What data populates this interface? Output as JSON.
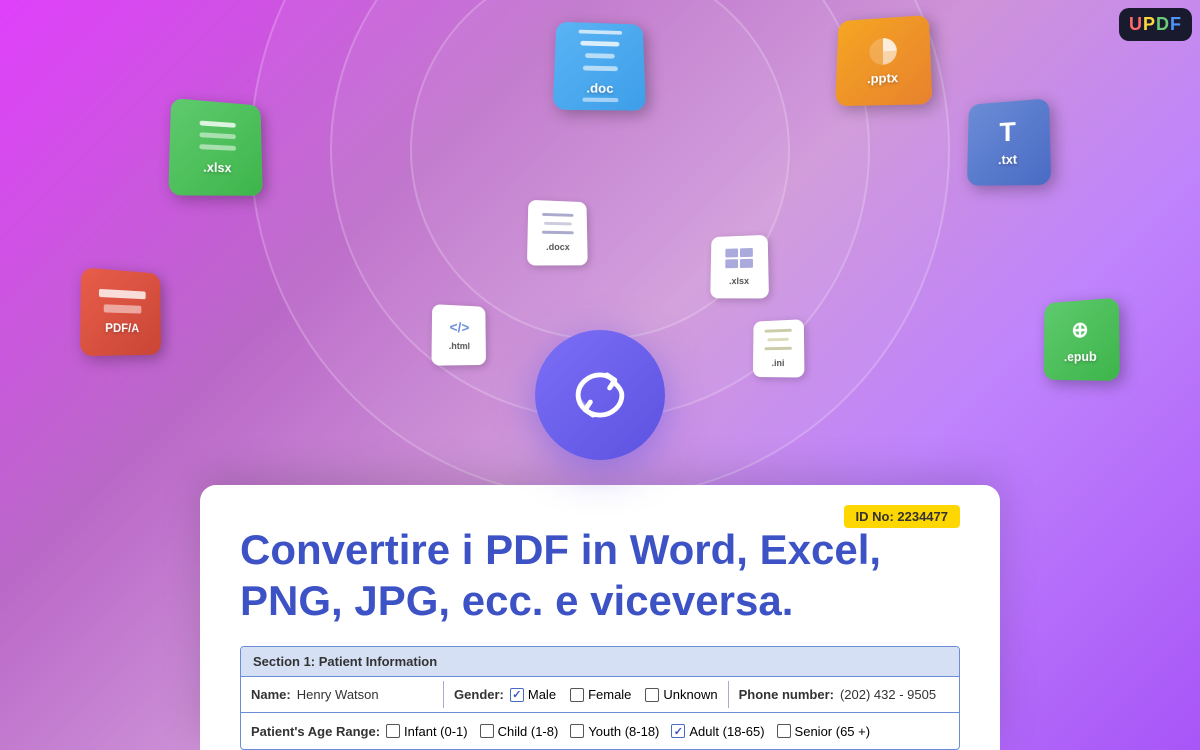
{
  "app": {
    "logo": "UPDF",
    "logo_letters": [
      "U",
      "P",
      "D",
      "F"
    ]
  },
  "hero": {
    "id_badge": "ID No: 2234477",
    "title_line1": "Convertire i PDF in Word, Excel,",
    "title_line2": "PNG, JPG, ecc. e viceversa.",
    "center_icon_title": "convert-icon"
  },
  "file_icons": [
    {
      "name": ".doc",
      "color_from": "#5ab4f5",
      "color_to": "#3d9ee8",
      "type": "doc"
    },
    {
      "name": ".pptx",
      "color_from": "#f5a623",
      "color_to": "#e8822d",
      "type": "pptx"
    },
    {
      "name": ".xlsx",
      "color_from": "#5fca6e",
      "color_to": "#3db54a",
      "type": "xlsx-large"
    },
    {
      "name": ".txt",
      "color_from": "#6b8dd6",
      "color_to": "#4a6bc4",
      "type": "txt"
    },
    {
      "name": "PDF/A",
      "color_from": "#e85d4a",
      "color_to": "#c94535",
      "type": "pdfa"
    },
    {
      "name": ".epub",
      "color_from": "#5fca6e",
      "color_to": "#3db54a",
      "type": "epub"
    },
    {
      "name": ".docx",
      "type": "small-white"
    },
    {
      "name": ".xlsx",
      "type": "small-white-2"
    },
    {
      "name": ".html",
      "type": "small-white-3"
    },
    {
      "name": ".ini",
      "type": "small-white-4"
    }
  ],
  "patient_form": {
    "section_header": "Section 1: Patient Information",
    "name_label": "Name:",
    "name_value": "Henry Watson",
    "gender_label": "Gender:",
    "genders": [
      {
        "label": "Male",
        "checked": true
      },
      {
        "label": "Female",
        "checked": false
      },
      {
        "label": "Unknown",
        "checked": false
      }
    ],
    "phone_label": "Phone number:",
    "phone_value": "(202) 432 - 9505",
    "age_range_label": "Patient's Age Range:",
    "age_ranges": [
      {
        "label": "Infant (0-1)",
        "checked": false
      },
      {
        "label": "Child (1-8)",
        "checked": false
      },
      {
        "label": "Youth (8-18)",
        "checked": false
      },
      {
        "label": "Adult (18-65)",
        "checked": true
      },
      {
        "label": "Senior (65 +)",
        "checked": false
      }
    ]
  }
}
